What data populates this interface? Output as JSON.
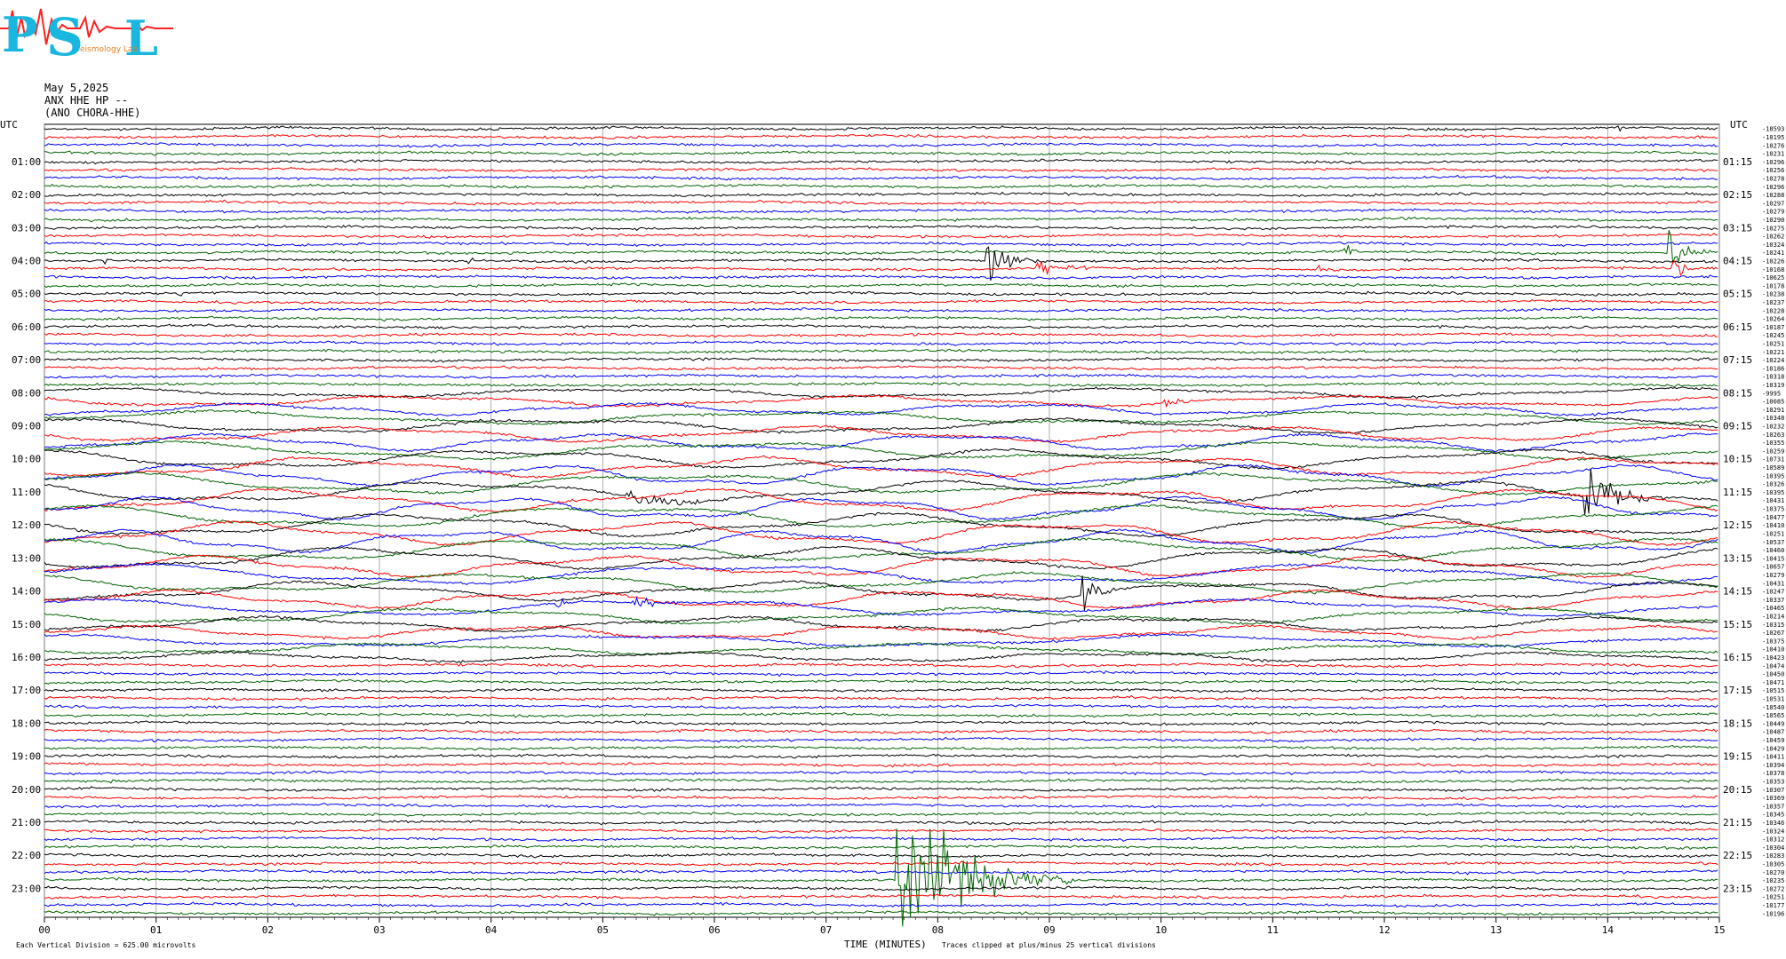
{
  "logo": {
    "letters": [
      "P",
      "S",
      "L"
    ],
    "subtext": "eismology Lab",
    "colors": {
      "cyan": "#19b6e0",
      "red": "#ff2020",
      "orange": "#e88020"
    }
  },
  "header": {
    "date": "May 5,2025",
    "channel": "ANX HHE HP --",
    "station": "(ANO CHORA-HHE)"
  },
  "utc_label_left": "UTC",
  "utc_label_right": "UTC",
  "left_hour_labels": [
    "01:00",
    "02:00",
    "03:00",
    "04:00",
    "05:00",
    "06:00",
    "07:00",
    "08:00",
    "09:00",
    "10:00",
    "11:00",
    "12:00",
    "13:00",
    "14:00",
    "15:00",
    "16:00",
    "17:00",
    "18:00",
    "19:00",
    "20:00",
    "21:00",
    "22:00",
    "23:00"
  ],
  "right_hour_labels": [
    "01:15",
    "02:15",
    "03:15",
    "04:15",
    "05:15",
    "06:15",
    "07:15",
    "08:15",
    "09:15",
    "10:15",
    "11:15",
    "12:15",
    "13:15",
    "14:15",
    "15:15",
    "16:15",
    "17:15",
    "18:15",
    "19:15",
    "20:15",
    "21:15",
    "22:15",
    "23:15"
  ],
  "trace_offsets": [
    "-18593",
    "-10195",
    "-10276",
    "-10231",
    "-10296",
    "-10256",
    "-10278",
    "-10296",
    "-10288",
    "-10297",
    "-10279",
    "-10290",
    "-10275",
    "-10262",
    "-10324",
    "-10241",
    "-10226",
    "-10168",
    "-10625",
    "-10178",
    "-10238",
    "-10237",
    "-10228",
    "-10264",
    "-10187",
    "-10245",
    "-10251",
    "-10221",
    "-10224",
    "-10186",
    "-10318",
    "-10319",
    "-9995",
    "-10085",
    "-10291",
    "-10348",
    "-10232",
    "-10263",
    "-10355",
    "-10259",
    "-10731",
    "-10589",
    "-10395",
    "-10326",
    "-10395",
    "-10431",
    "-10375",
    "-10477",
    "-10410",
    "-10251",
    "-10537",
    "-10460",
    "-10415",
    "-10657",
    "-10279",
    "-10431",
    "-10247",
    "-10337",
    "-10465",
    "-10214",
    "-10315",
    "-10267",
    "-10375",
    "-10410",
    "-10423",
    "-10474",
    "-10450",
    "-10471",
    "-10515",
    "-10531",
    "-10540",
    "-10565",
    "-10449",
    "-10487",
    "-10459",
    "-10429",
    "-10411",
    "-10394",
    "-10378",
    "-10353",
    "-10307",
    "-10369",
    "-10357",
    "-10345",
    "-10346",
    "-10324",
    "-10312",
    "-10304",
    "-10283",
    "-10305",
    "-10270",
    "-10235",
    "-10272",
    "-10251",
    "-10177",
    "-10196"
  ],
  "footer": {
    "division_note": "Each Vertical Division = 625.00 microvolts",
    "clip_note": "Traces clipped at plus/minus 25 vertical divisions"
  },
  "chart_data": {
    "type": "line",
    "title": "",
    "xlabel": "TIME (MINUTES)",
    "ylabel": "UTC",
    "xlim": [
      0,
      15
    ],
    "x_ticks": [
      "00",
      "01",
      "02",
      "03",
      "04",
      "05",
      "06",
      "07",
      "08",
      "09",
      "10",
      "11",
      "12",
      "13",
      "14",
      "15"
    ],
    "n_traces": 96,
    "trace_minutes": 15,
    "color_cycle": [
      "#000000",
      "#ff0000",
      "#0000ff",
      "#006400"
    ],
    "events": [
      {
        "trace": 0,
        "minute": 14.1,
        "amp": 5,
        "dur": 0.08,
        "label": "small red blip near 00:00"
      },
      {
        "trace": 16,
        "minute": 0.55,
        "amp": 7,
        "dur": 0.1
      },
      {
        "trace": 16,
        "minute": 3.75,
        "amp": 5,
        "dur": 0.25
      },
      {
        "trace": 16,
        "minute": 8.45,
        "amp": 38,
        "dur": 0.45
      },
      {
        "trace": 15,
        "minute": 11.65,
        "amp": 9,
        "dur": 0.25
      },
      {
        "trace": 15,
        "minute": 14.55,
        "amp": 22,
        "dur": 0.45
      },
      {
        "trace": 17,
        "minute": 8.9,
        "amp": 8,
        "dur": 0.6
      },
      {
        "trace": 17,
        "minute": 11.4,
        "amp": 4,
        "dur": 0.3
      },
      {
        "trace": 17,
        "minute": 14.6,
        "amp": 14,
        "dur": 0.4
      },
      {
        "trace": 20,
        "minute": 1.2,
        "amp": 5,
        "dur": 0.3
      },
      {
        "trace": 33,
        "minute": 10.05,
        "amp": 6,
        "dur": 0.3
      },
      {
        "trace": 36,
        "minute": 3.5,
        "amp": 4,
        "dur": 0.5
      },
      {
        "trace": 44,
        "minute": 5.2,
        "amp": 8,
        "dur": 1.5
      },
      {
        "trace": 44,
        "minute": 13.8,
        "amp": 42,
        "dur": 0.8
      },
      {
        "trace": 56,
        "minute": 9.3,
        "amp": 20,
        "dur": 0.4
      },
      {
        "trace": 58,
        "minute": 4.6,
        "amp": 6,
        "dur": 0.4
      },
      {
        "trace": 58,
        "minute": 5.3,
        "amp": 8,
        "dur": 0.5
      },
      {
        "trace": 79,
        "minute": 0.6,
        "amp": 5,
        "dur": 0.2
      },
      {
        "trace": 91,
        "minute": 7.65,
        "amp": 90,
        "dur": 1.6
      }
    ],
    "grid": true
  }
}
